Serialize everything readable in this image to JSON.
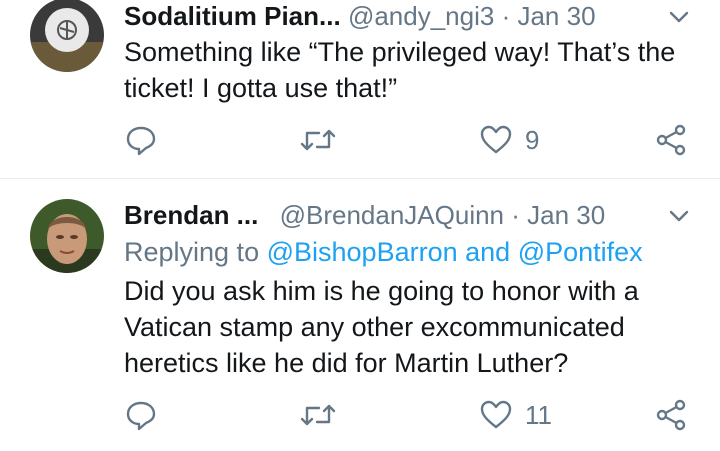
{
  "tweets": [
    {
      "name": "Sodalitium Pian...",
      "handle": "@andy_ngi3",
      "separator": "·",
      "date": "Jan 30",
      "text": "Something like “The privileged way! That’s the ticket! I gotta use that!”",
      "reply_count": "",
      "retweet_count": "",
      "like_count": "9"
    },
    {
      "name": "Brendan ...",
      "handle": "@BrendanJAQuinn",
      "separator": "·",
      "date": "Jan 30",
      "replying_label": "Replying to",
      "replying_mention1": "@BishopBarron",
      "replying_and": "and",
      "replying_mention2": "@Pontifex",
      "text": "Did you ask him is he going to honor with a Vatican stamp any other excommunicated heretics like he did for Martin Luther?",
      "reply_count": "",
      "retweet_count": "",
      "like_count": "11"
    }
  ],
  "colors": {
    "text": "#14171a",
    "secondary": "#657786",
    "link": "#1da1f2",
    "divider": "#e6ecf0"
  }
}
